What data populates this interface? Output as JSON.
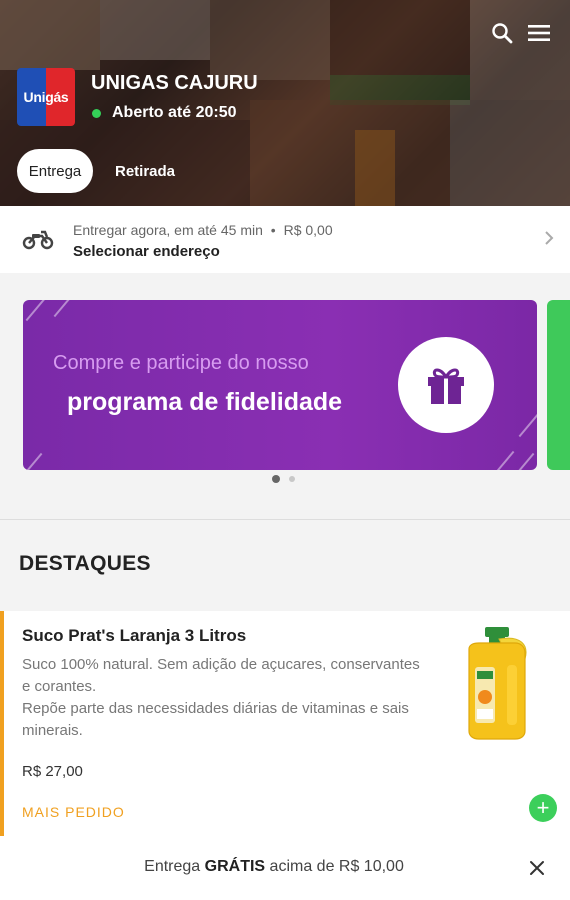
{
  "store": {
    "logo_text": "Unigás",
    "name": "UNIGAS CAJURU",
    "status": "Aberto até 20:50",
    "status_color": "#34d058"
  },
  "header_icons": [
    "search-icon",
    "menu-icon"
  ],
  "tabs": [
    {
      "label": "Entrega",
      "active": true
    },
    {
      "label": "Retirada",
      "active": false
    }
  ],
  "delivery": {
    "icon": "motorcycle-icon",
    "time_text": "Entregar agora, em até 45 min",
    "separator": "•",
    "fee": "R$ 0,00",
    "address_label": "Selecionar endereço"
  },
  "banner": {
    "line1": "Compre e participe do nosso",
    "line2": "programa de fidelidade",
    "icon": "gift-icon",
    "colors": {
      "background": "#8a2fb3",
      "next_slide": "#3fc95a"
    },
    "page_count": 2,
    "current_page": 1
  },
  "section": {
    "title": "DESTAQUES"
  },
  "product": {
    "title": "Suco Prat's Laranja 3 Litros",
    "description_1": "Suco 100% natural. Sem adição de açucares, conservantes e corantes.",
    "description_2": "Repõe parte das necessidades diárias de vitaminas e sais minerais.",
    "price": "R$ 27,00",
    "badge": "MAIS PEDIDO",
    "accent_color": "#f0a020",
    "add_label": "+"
  },
  "bottom_bar": {
    "prefix": "Entrega ",
    "highlight": "GRÁTIS",
    "suffix": " acima de R$ 10,00"
  }
}
